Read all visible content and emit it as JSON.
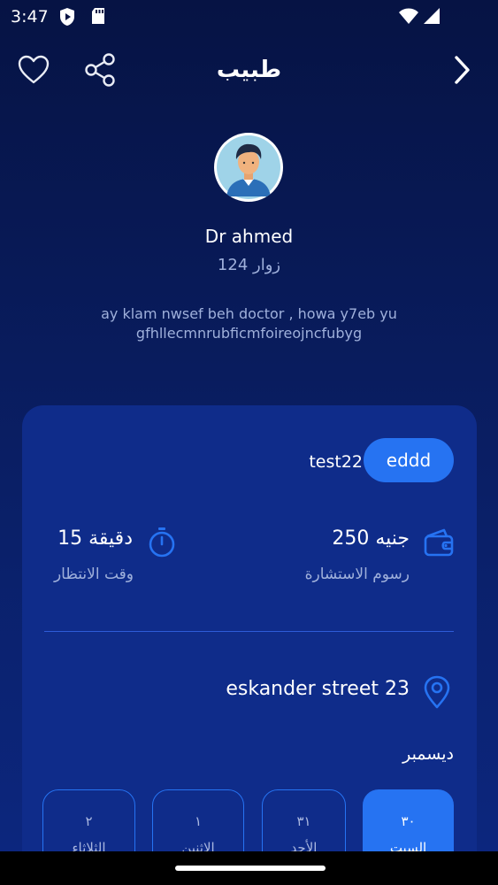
{
  "status": {
    "time": "3:47"
  },
  "header": {
    "title": "طبيب",
    "icons": [
      "heart-icon",
      "share-icon",
      "chevron-right-icon"
    ]
  },
  "doctor": {
    "name": "Dr ahmed",
    "visits": "124 زوار",
    "bio": "ay klam nwsef beh doctor , howa y7eb yugfhllecmnrubficmfoireojncfubyg"
  },
  "card": {
    "tag_text": "test22",
    "pill_label": "eddd",
    "fee_value": "250 جنيه",
    "fee_label": "رسوم الاستشارة",
    "wait_value": "15 دقيقة",
    "wait_label": "وقت الانتظار",
    "address": "eskander street 23",
    "month": "ديسمبر",
    "days": [
      {
        "num": "٣٠",
        "name": "السبت",
        "selected": true
      },
      {
        "num": "٣١",
        "name": "الأحد",
        "selected": false
      },
      {
        "num": "١",
        "name": "الاثنين",
        "selected": false
      },
      {
        "num": "٢",
        "name": "الثلاثاء",
        "selected": false
      }
    ]
  },
  "colors": {
    "background_top": "#061344",
    "card": "#0f2c8a",
    "accent": "#2673f2",
    "muted_text": "#9fb0db"
  }
}
